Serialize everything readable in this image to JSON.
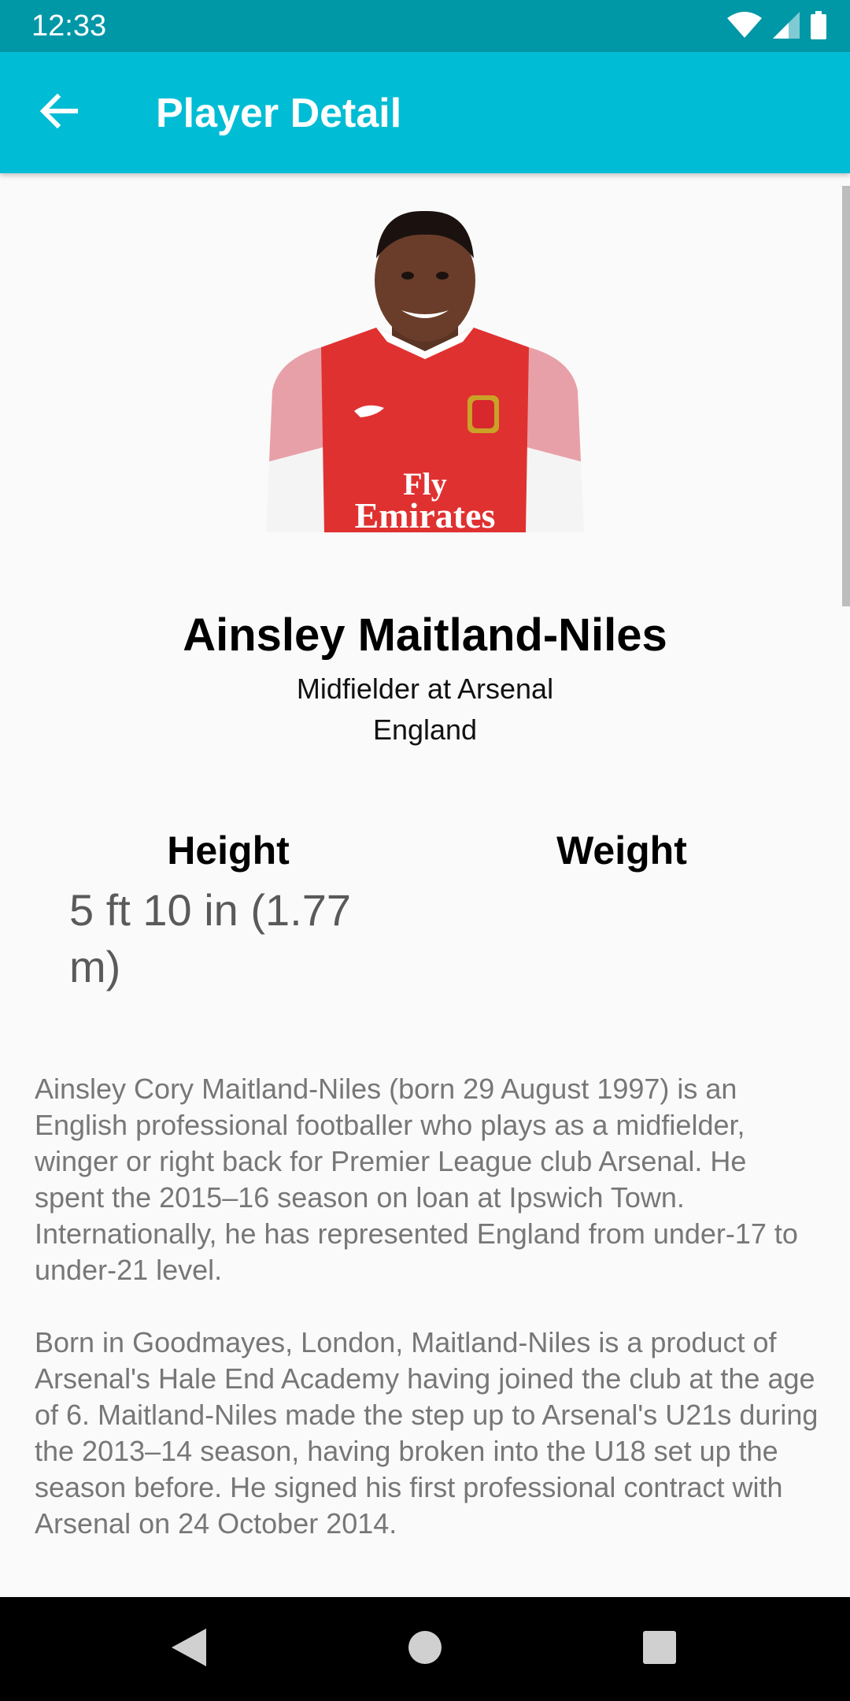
{
  "status_bar": {
    "time": "12:33"
  },
  "app_bar": {
    "title": "Player Detail"
  },
  "player": {
    "name": "Ainsley Maitland-Niles",
    "position": "Midfielder at Arsenal",
    "nation": "England",
    "height_label": "Height",
    "height_value": "5 ft 10 in (1.77 m)",
    "weight_label": "Weight",
    "weight_value": "",
    "shirt_text": "Fly Emirates"
  },
  "bio": {
    "paragraph1": "Ainsley Cory Maitland-Niles (born 29 August 1997) is an English professional footballer who plays as a midfielder, winger or right back for Premier League club Arsenal. He spent the 2015–16 season on loan at Ipswich Town. Internationally, he has represented England from under-17 to under-21 level.",
    "paragraph2": "Born in Goodmayes, London, Maitland-Niles is a product of Arsenal's Hale End Academy having joined the club at the age of 6. Maitland-Niles made the step up to Arsenal's U21s during the 2013–14 season, having broken into the U18 set up the season before. He signed his first professional contract with Arsenal on 24 October 2014."
  },
  "icons": {
    "back": "arrow-back-icon",
    "wifi": "wifi-icon",
    "signal": "signal-icon",
    "battery": "battery-icon",
    "nav_back": "nav-back-icon",
    "nav_home": "nav-home-icon",
    "nav_recents": "nav-recents-icon"
  },
  "colors": {
    "status_bar": "#0097a7",
    "app_bar": "#00bcd4",
    "background": "#fafafa",
    "shirt_red": "#e03131"
  }
}
